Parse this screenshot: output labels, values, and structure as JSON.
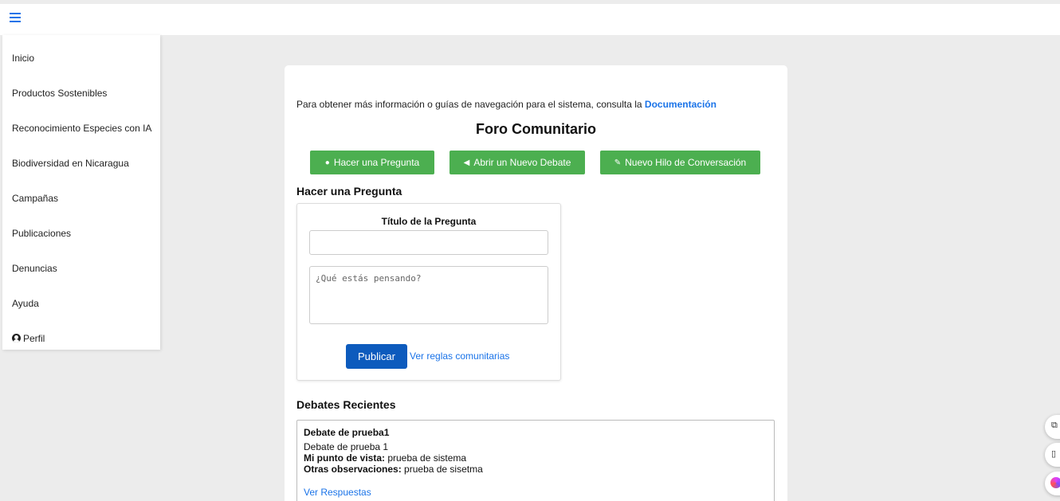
{
  "sidebar": {
    "items": [
      {
        "label": "Inicio"
      },
      {
        "label": "Productos Sostenibles"
      },
      {
        "label": "Reconocimiento Especies con IA"
      },
      {
        "label": "Biodiversidad en Nicaragua"
      },
      {
        "label": "Campañas"
      },
      {
        "label": "Publicaciones"
      },
      {
        "label": "Denuncias"
      },
      {
        "label": "Ayuda"
      },
      {
        "label": "Perfil",
        "icon": "user-circle-icon"
      }
    ]
  },
  "main": {
    "info_text": "Para obtener más información o guías de navegación para el sistema, consulta la ",
    "info_link": "Documentación",
    "title": "Foro Comunitario",
    "actions": [
      {
        "label": "Hacer una Pregunta",
        "icon": "speech-bubble-icon"
      },
      {
        "label": "Abrir un Nuevo Debate",
        "icon": "megaphone-icon"
      },
      {
        "label": "Nuevo Hilo de Conversación",
        "icon": "thread-icon"
      }
    ],
    "question_section": {
      "heading": "Hacer una Pregunta",
      "title_label": "Título de la Pregunta",
      "title_value": "",
      "body_placeholder": "¿Qué estás pensando?",
      "publish_label": "Publicar",
      "rules_link": "Ver reglas comunitarias"
    },
    "debates_section": {
      "heading": "Debates Recientes",
      "items": [
        {
          "title": "Debate de prueba1",
          "description": "Debate de prueba 1",
          "viewpoint_label": "Mi punto de vista:",
          "viewpoint": " prueba de sistema",
          "observations_label": "Otras observaciones:",
          "observations": " prueba de sisetma",
          "link": "Ver Respuestas"
        }
      ]
    }
  },
  "colors": {
    "accent_green": "#4caf50",
    "primary_blue": "#0d5bbd",
    "link_blue": "#1a73e8",
    "page_bg": "#ececec"
  }
}
